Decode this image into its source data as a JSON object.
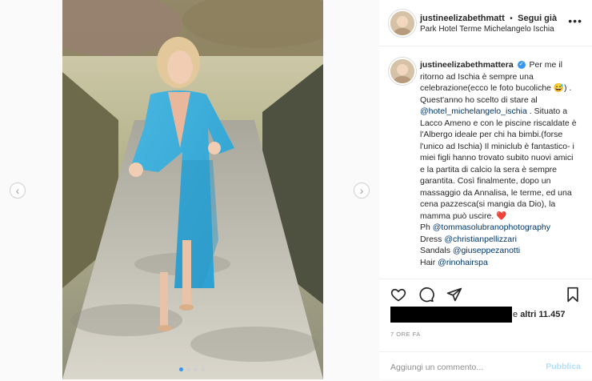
{
  "post": {
    "header": {
      "username": "justineelizabethmatt",
      "separator": "•",
      "follow_label": "Segui già",
      "location": "Park Hotel Terme Michelangelo Ischia",
      "more_icon": "ellipsis-icon"
    },
    "caption": {
      "username": "justineelizabethmattera",
      "verified_icon": "verified-badge-icon",
      "text_1": "Per me il ritorno ad Ischia è sempre una celebrazione(ecco le foto bucoliche 😅) . Quest'anno ho scelto di stare al ",
      "mention_hotel": "@hotel_michelangelo_ischia",
      "text_2": ". Situato a Lacco Ameno e con le piscine riscaldate è l'Albergo ideale per chi ha bimbi.(forse l'unico ad Ischia) Il miniclub è fantastico- i miei figli hanno trovato subito nuovi amici e la partita di calcio la sera è sempre garantita. Così finalmente, dopo un massaggio da Annalisa, le terme, ed una cena pazzesca(si mangia da Dio), la mamma può uscire. ❤️",
      "ph_label": "Ph ",
      "ph_mention": "@tommasolubranophotography",
      "dress_label": "Dress ",
      "dress_mention": "@christianpellizzari",
      "sandals_label": "Sandals ",
      "sandals_mention": "@giuseppezanotti",
      "hair_label": "Hair ",
      "hair_mention": "@rinohairspa"
    },
    "actions": {
      "like_icon": "heart-icon",
      "comment_icon": "comment-bubble-icon",
      "share_icon": "paper-plane-icon",
      "save_icon": "bookmark-icon"
    },
    "likes": {
      "prefix": "e",
      "count": "altri 11.457"
    },
    "timestamp": "7 ORE FA",
    "comment": {
      "placeholder": "Aggiungi un commento...",
      "publish_label": "Pubblica"
    },
    "carousel": {
      "prev_icon": "chevron-left-icon",
      "next_icon": "chevron-right-icon",
      "dot_count": 4,
      "active_dot": 1
    }
  }
}
